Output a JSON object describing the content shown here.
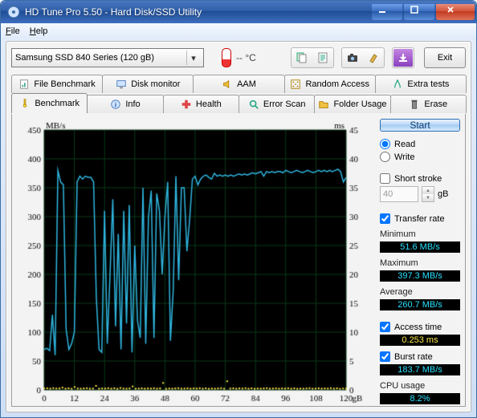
{
  "window": {
    "title": "HD Tune Pro 5.50 - Hard Disk/SSD Utility"
  },
  "menu": {
    "file": "File",
    "help": "Help"
  },
  "toolbar": {
    "drive": "Samsung SSD 840 Series (120 gB)",
    "temp": "-- °C",
    "exit": "Exit"
  },
  "tabs_row1": [
    {
      "label": "File Benchmark",
      "icon": "file-bench"
    },
    {
      "label": "Disk monitor",
      "icon": "monitor"
    },
    {
      "label": "AAM",
      "icon": "speaker"
    },
    {
      "label": "Random Access",
      "icon": "random"
    },
    {
      "label": "Extra tests",
      "icon": "extra"
    }
  ],
  "tabs_row2": [
    {
      "label": "Benchmark",
      "icon": "bench",
      "active": true
    },
    {
      "label": "Info",
      "icon": "info"
    },
    {
      "label": "Health",
      "icon": "health"
    },
    {
      "label": "Error Scan",
      "icon": "scan"
    },
    {
      "label": "Folder Usage",
      "icon": "folder"
    },
    {
      "label": "Erase",
      "icon": "erase"
    }
  ],
  "side": {
    "start": "Start",
    "read": "Read",
    "write": "Write",
    "short_stroke": "Short stroke",
    "stroke_value": "40",
    "stroke_unit": "gB",
    "transfer_rate": "Transfer rate",
    "minimum_l": "Minimum",
    "minimum_v": "51.6",
    "maximum_l": "Maximum",
    "maximum_v": "397.3",
    "average_l": "Average",
    "average_v": "260.7",
    "rate_unit": "MB/s",
    "access_time_l": "Access time",
    "access_time_v": "0.253",
    "access_time_u": "ms",
    "burst_l": "Burst rate",
    "burst_v": "183.7",
    "cpu_l": "CPU usage",
    "cpu_v": "8.2%"
  },
  "chart_data": {
    "type": "line",
    "xlabel": "gB",
    "ylabel_left": "MB/s",
    "ylabel_right": "ms",
    "xlim": [
      0,
      120
    ],
    "ylim_left": [
      0,
      450
    ],
    "ylim_right": [
      0,
      45
    ],
    "x_ticks": [
      0,
      12,
      24,
      36,
      48,
      60,
      72,
      84,
      96,
      108,
      120
    ],
    "y_ticks_left": [
      0,
      50,
      100,
      150,
      200,
      250,
      300,
      350,
      400,
      450
    ],
    "y_ticks_right": [
      0,
      5,
      10,
      15,
      20,
      25,
      30,
      35,
      40,
      45
    ],
    "series": [
      {
        "name": "transfer_rate",
        "axis": "left",
        "color": "#2fb6e0",
        "values": [
          70,
          72,
          68,
          130,
          60,
          380,
          360,
          355,
          105,
          70,
          80,
          100,
          360,
          370,
          365,
          370,
          368,
          368,
          360,
          160,
          70,
          65,
          310,
          80,
          200,
          330,
          110,
          270,
          70,
          310,
          115,
          320,
          65,
          250,
          120,
          90,
          350,
          80,
          300,
          345,
          90,
          340,
          310,
          200,
          300,
          360,
          85,
          170,
          370,
          190,
          350,
          350,
          240,
          295,
          365,
          370,
          355,
          365,
          370,
          372,
          368,
          365,
          375,
          370,
          372,
          370,
          372,
          370,
          372,
          370,
          372,
          374,
          372,
          374,
          372,
          374,
          376,
          374,
          376,
          378,
          370,
          378,
          376,
          378,
          376,
          378,
          378,
          376,
          380,
          378,
          376,
          378,
          380,
          378,
          376,
          378,
          380,
          378,
          376,
          378,
          380,
          378,
          380,
          378,
          380,
          378,
          380,
          382,
          378,
          360,
          368
        ]
      },
      {
        "name": "access_time",
        "axis": "right",
        "color": "#ffe94a",
        "scatter": true,
        "values": [
          0.25,
          0.28,
          0.22,
          0.3,
          0.24,
          0.26,
          0.4,
          0.22,
          0.28,
          0.2,
          0.5,
          0.24,
          0.22,
          0.26,
          0.3,
          0.22,
          0.24,
          0.7,
          0.22,
          0.26,
          0.24,
          0.3,
          0.22,
          0.28,
          0.2,
          0.34,
          0.24,
          0.22,
          0.26,
          0.6,
          0.22,
          0.24,
          0.28,
          0.22,
          0.26,
          0.24,
          0.3,
          0.22,
          0.28,
          1.2,
          0.2,
          0.24,
          0.22,
          0.26,
          0.3,
          0.22,
          0.24,
          0.28,
          0.22,
          0.26,
          0.24,
          0.3,
          0.22,
          0.28,
          0.2,
          0.24,
          0.22,
          0.26,
          0.3,
          0.22,
          1.5,
          0.24,
          0.28,
          0.22,
          0.26,
          0.24,
          0.3,
          0.22,
          0.28,
          0.2,
          0.24,
          0.22,
          0.26,
          0.3,
          0.22,
          0.24,
          0.28,
          0.22,
          0.26,
          0.24,
          0.3,
          0.22,
          0.28,
          0.2,
          0.24,
          0.22,
          0.26,
          0.3,
          0.22,
          0.24,
          0.28,
          0.22,
          0.26,
          0.24,
          0.3,
          0.22,
          0.28,
          0.2,
          0.24,
          0.22
        ]
      }
    ]
  }
}
